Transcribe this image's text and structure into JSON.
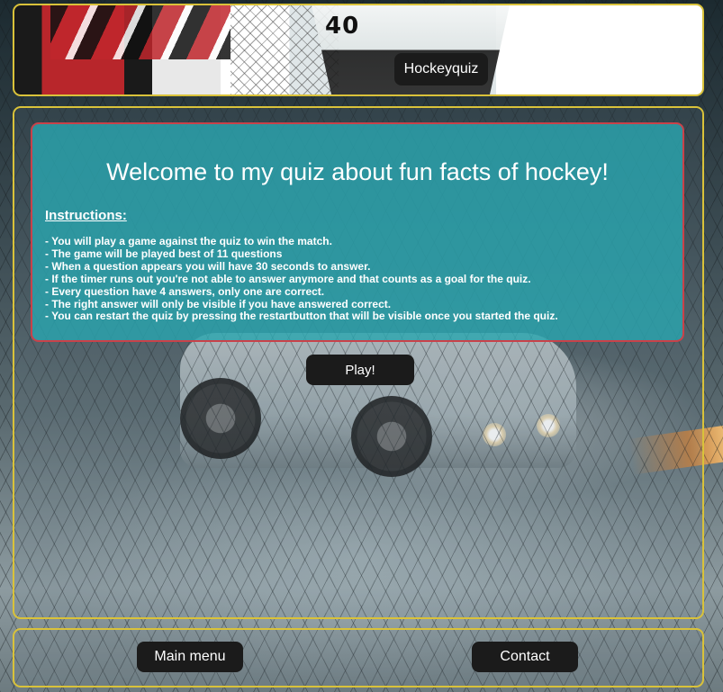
{
  "header": {
    "brand_label": "Hockeyquiz",
    "jersey_number": "40"
  },
  "main": {
    "title": "Welcome to my quiz about fun facts of hockey!",
    "instructions_label": "Instructions:",
    "rules": [
      "- You will play a game against the quiz to win the match.",
      "- The game will be played best of 11 questions",
      "- When a question appears you will have 30 seconds to answer.",
      "- If the timer runs out you're not able to answer anymore and that counts as a goal for the quiz.",
      "- Every question have 4 answers, only one are correct.",
      "- The right answer will only be visible if you have answered correct.",
      "- You can restart the quiz by pressing the restartbutton that will be visible once you started the quiz."
    ],
    "play_label": "Play!"
  },
  "footer": {
    "menu_label": "Main menu",
    "contact_label": "Contact"
  },
  "colors": {
    "panel_border": "#d9c23a",
    "card_background": "#2aa5af",
    "card_border": "#c9424a",
    "button_background": "#1b1b1b"
  }
}
